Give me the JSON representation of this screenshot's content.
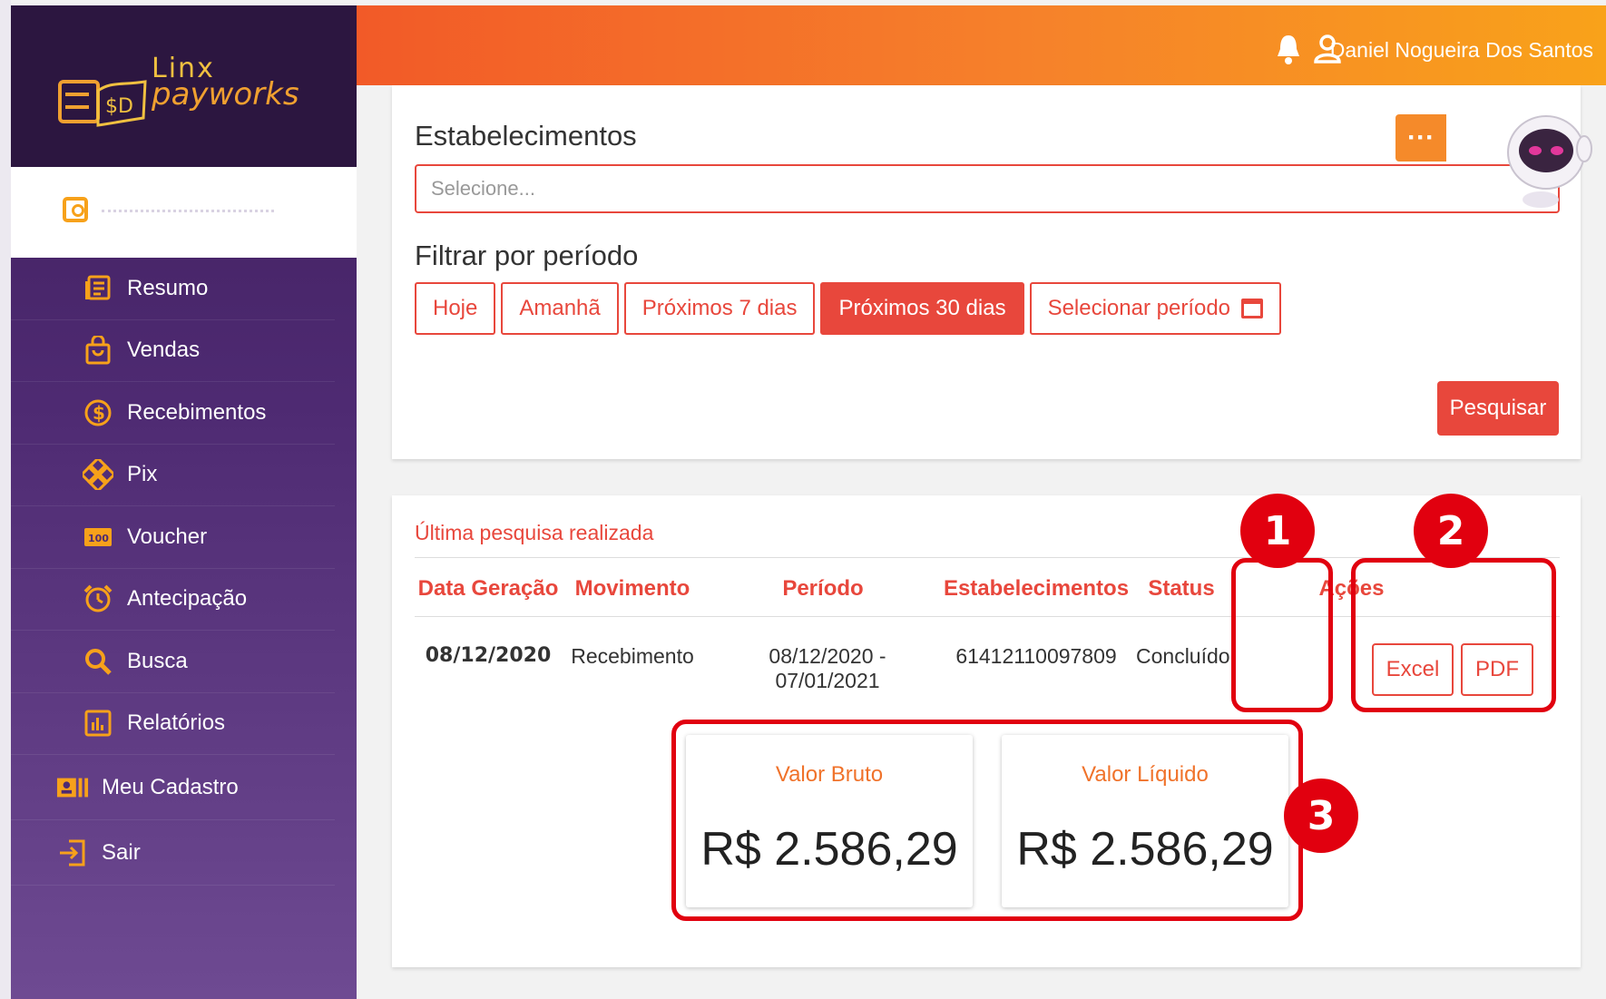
{
  "brand": {
    "logo_top": "Linx",
    "logo_bottom": "payworks",
    "accent": "#e8473c",
    "orange": "#f7a11a",
    "annotation_red": "#e1000f"
  },
  "header": {
    "user_name": "Daniel Nogueira Dos Santos"
  },
  "sidebar": {
    "items": [
      {
        "label": "Resumo",
        "icon": "newspaper-icon"
      },
      {
        "label": "Vendas",
        "icon": "shopping-bag-icon"
      },
      {
        "label": "Recebimentos",
        "icon": "dollar-circle-icon"
      },
      {
        "label": "Pix",
        "icon": "pix-icon"
      },
      {
        "label": "Voucher",
        "icon": "voucher-icon"
      },
      {
        "label": "Antecipação",
        "icon": "alarm-clock-icon"
      },
      {
        "label": "Busca",
        "icon": "search-icon"
      },
      {
        "label": "Relatórios",
        "icon": "report-chart-icon"
      }
    ],
    "top_items": [
      {
        "label": "Meu Cadastro",
        "icon": "id-card-icon"
      },
      {
        "label": "Sair",
        "icon": "logout-icon"
      }
    ]
  },
  "filters": {
    "establishments_label": "Estabelecimentos",
    "establishments_placeholder": "Selecione...",
    "more_label": "···",
    "period_label": "Filtrar por período",
    "period_buttons": [
      "Hoje",
      "Amanhã",
      "Próximos 7 dias",
      "Próximos 30 dias",
      "Selecionar período"
    ],
    "active_period": "Próximos 30 dias",
    "search_label": "Pesquisar"
  },
  "results": {
    "title": "Última pesquisa realizada",
    "columns": [
      "Data Geração",
      "Movimento",
      "Período",
      "Estabelecimentos",
      "Status",
      "Ações"
    ],
    "row": {
      "date": "08/12/2020",
      "movement": "Recebimento",
      "period": "08/12/2020 - 07/01/2021",
      "establishment": "61412110097809",
      "status": "Concluído"
    },
    "actions": [
      "Excel",
      "PDF"
    ],
    "gross_label": "Valor Bruto",
    "gross_value": "R$ 2.586,29",
    "net_label": "Valor Líquido",
    "net_value": "R$ 2.586,29"
  },
  "annotations": [
    "1",
    "2",
    "3"
  ]
}
